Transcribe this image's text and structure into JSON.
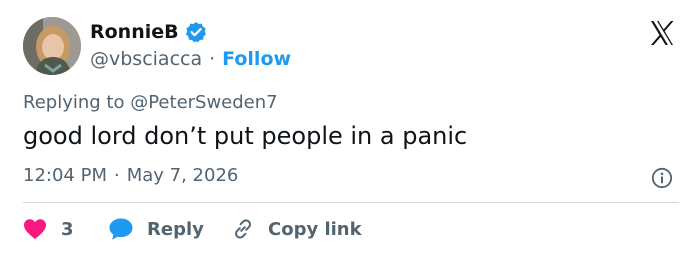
{
  "author": {
    "display_name": "RonnieB",
    "handle": "@vbsciacca",
    "separator": "·",
    "follow_label": "Follow",
    "verified": true
  },
  "reply_context": {
    "prefix": "Replying to",
    "handle": "@PeterSweden7"
  },
  "tweet": {
    "text": "good lord don’t put people in a panic",
    "time": "12:04 PM",
    "separator": "·",
    "date": "May 7, 2026"
  },
  "actions": {
    "like_count": "3",
    "reply_label": "Reply",
    "copy_link_label": "Copy link"
  },
  "icons": {
    "brand": "x-logo-icon",
    "verified": "verified-badge-icon",
    "info": "info-icon",
    "like": "heart-icon",
    "reply": "speech-bubble-icon",
    "copy": "link-icon"
  },
  "colors": {
    "accent": "#1d9bf0",
    "like": "#f91880",
    "text_primary": "#0f1419",
    "text_secondary": "#536471",
    "divider": "#cfd9de"
  }
}
